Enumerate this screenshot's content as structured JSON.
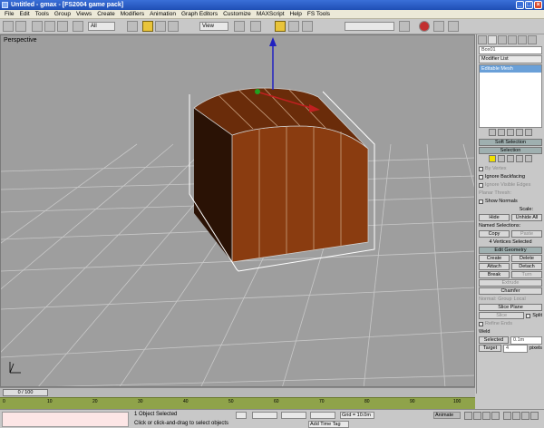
{
  "window": {
    "title": "Untitled - gmax - [FS2004 game pack]"
  },
  "menu": [
    "File",
    "Edit",
    "Tools",
    "Group",
    "Views",
    "Create",
    "Modifiers",
    "Animation",
    "Graph Editors",
    "Customize",
    "MAXScript",
    "Help",
    "FS Tools"
  ],
  "toolbar": {
    "selection_filter": "All",
    "view_dropdown": "View"
  },
  "viewport": {
    "label": "Perspective"
  },
  "cmdpanel": {
    "object_name": "Box01",
    "modifier_list": "Modifier List",
    "stack_item": "Editable Mesh",
    "soft_selection": "Soft Selection",
    "selection_header": "Selection",
    "by_vertex": "By Vertex",
    "ignore_backfacing": "Ignore Backfacing",
    "ignore_visible_edges": "Ignore Visible Edges",
    "planar_thresh": "Planar Thresh:",
    "show_normals": "Show Normals",
    "scale_label": "Scale:",
    "hide": "Hide",
    "unhide_all": "Unhide All",
    "named_selections": "Named Selections:",
    "copy": "Copy",
    "paste": "Paste",
    "vertices_selected": "4 Vertices Selected",
    "edit_geometry": "Edit Geometry",
    "create": "Create",
    "delete": "Delete",
    "attach": "Attach",
    "detach": "Detach",
    "break": "Break",
    "turn": "Turn",
    "extrude": "Extrude",
    "chamfer": "Chamfer",
    "normal_label": "Normal:",
    "group": "Group",
    "local": "Local",
    "slice_plane": "Slice Plane",
    "slice": "Slice",
    "split": "Split",
    "refine_ends": "Refine Ends",
    "weld": "Weld",
    "selected": "Selected",
    "selected_value": "0.1m",
    "target": "Target",
    "target_value": "4",
    "pixels": "pixels"
  },
  "timebar": {
    "slider": "0 / 100"
  },
  "trackbar": {
    "ticks": [
      "0",
      "10",
      "20",
      "30",
      "40",
      "50",
      "60",
      "70",
      "80",
      "90",
      "100"
    ]
  },
  "status": {
    "objects": "1 Object Selected",
    "prompt": "Click or click-and-drag to select objects",
    "add_time_tag": "Add Time Tag",
    "grid": "Grid = 10.0m",
    "animate": "Animate"
  },
  "colors": {
    "box_front": "#8a3c10",
    "box_side": "#2a1205",
    "grid_bg": "#9e9e9e"
  }
}
